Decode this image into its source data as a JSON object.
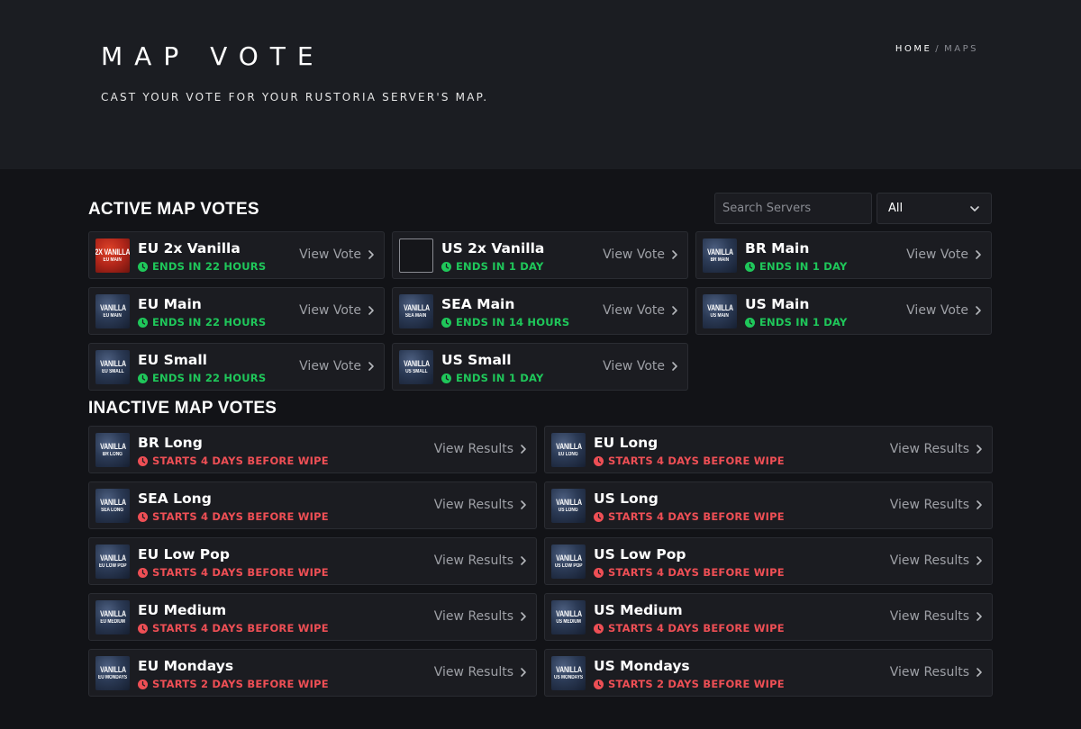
{
  "header": {
    "title": "MAP VOTE",
    "subtitle": "CAST YOUR VOTE FOR YOUR RUSTORIA SERVER'S MAP.",
    "breadcrumb": {
      "home": "HOME",
      "separator": "/",
      "current": "MAPS"
    }
  },
  "active": {
    "heading": "ACTIVE MAP VOTES",
    "search_placeholder": "Search Servers",
    "filter_value": "All",
    "action_label": "View Vote",
    "items": [
      {
        "name": "EU 2x Vanilla",
        "status": "ENDS IN 22 HOURS",
        "thumb_line1": "2X VANILLA",
        "thumb_line2": "EU MAIN",
        "thumb_style": "red"
      },
      {
        "name": "US 2x Vanilla",
        "status": "ENDS IN 1 DAY",
        "thumb_line1": "",
        "thumb_line2": "",
        "thumb_style": "empty"
      },
      {
        "name": "BR Main",
        "status": "ENDS IN 1 DAY",
        "thumb_line1": "VANILLA",
        "thumb_line2": "BR MAIN",
        "thumb_style": "blue"
      },
      {
        "name": "EU Main",
        "status": "ENDS IN 22 HOURS",
        "thumb_line1": "VANILLA",
        "thumb_line2": "EU MAIN",
        "thumb_style": "blue"
      },
      {
        "name": "SEA Main",
        "status": "ENDS IN 14 HOURS",
        "thumb_line1": "VANILLA",
        "thumb_line2": "SEA MAIN",
        "thumb_style": "blue"
      },
      {
        "name": "US Main",
        "status": "ENDS IN 1 DAY",
        "thumb_line1": "VANILLA",
        "thumb_line2": "US MAIN",
        "thumb_style": "blue"
      },
      {
        "name": "EU Small",
        "status": "ENDS IN 22 HOURS",
        "thumb_line1": "VANILLA",
        "thumb_line2": "EU SMALL",
        "thumb_style": "blue"
      },
      {
        "name": "US Small",
        "status": "ENDS IN 1 DAY",
        "thumb_line1": "VANILLA",
        "thumb_line2": "US SMALL",
        "thumb_style": "blue"
      }
    ]
  },
  "inactive": {
    "heading": "INACTIVE MAP VOTES",
    "action_label": "View Results",
    "items": [
      {
        "name": "BR Long",
        "status": "STARTS 4 DAYS BEFORE WIPE",
        "thumb_line1": "VANILLA",
        "thumb_line2": "BR LONG",
        "thumb_style": "blue"
      },
      {
        "name": "EU Long",
        "status": "STARTS 4 DAYS BEFORE WIPE",
        "thumb_line1": "VANILLA",
        "thumb_line2": "EU LONG",
        "thumb_style": "blue"
      },
      {
        "name": "SEA Long",
        "status": "STARTS 4 DAYS BEFORE WIPE",
        "thumb_line1": "VANILLA",
        "thumb_line2": "SEA LONG",
        "thumb_style": "blue"
      },
      {
        "name": "US Long",
        "status": "STARTS 4 DAYS BEFORE WIPE",
        "thumb_line1": "VANILLA",
        "thumb_line2": "US LONG",
        "thumb_style": "blue"
      },
      {
        "name": "EU Low Pop",
        "status": "STARTS 4 DAYS BEFORE WIPE",
        "thumb_line1": "VANILLA",
        "thumb_line2": "EU LOW POP",
        "thumb_style": "blue"
      },
      {
        "name": "US Low Pop",
        "status": "STARTS 4 DAYS BEFORE WIPE",
        "thumb_line1": "VANILLA",
        "thumb_line2": "US LOW POP",
        "thumb_style": "blue"
      },
      {
        "name": "EU Medium",
        "status": "STARTS 4 DAYS BEFORE WIPE",
        "thumb_line1": "VANILLA",
        "thumb_line2": "EU MEDIUM",
        "thumb_style": "blue"
      },
      {
        "name": "US Medium",
        "status": "STARTS 4 DAYS BEFORE WIPE",
        "thumb_line1": "VANILLA",
        "thumb_line2": "US MEDIUM",
        "thumb_style": "blue"
      },
      {
        "name": "EU Mondays",
        "status": "STARTS 2 DAYS BEFORE WIPE",
        "thumb_line1": "VANILLA",
        "thumb_line2": "EU MONDAYS",
        "thumb_style": "blue"
      },
      {
        "name": "US Mondays",
        "status": "STARTS 2 DAYS BEFORE WIPE",
        "thumb_line1": "VANILLA",
        "thumb_line2": "US MONDAYS",
        "thumb_style": "blue"
      }
    ]
  },
  "colors": {
    "active_status": "#1fc75a",
    "inactive_status": "#ee4f55",
    "background": "#121317",
    "hero_background": "#1b1d22"
  },
  "icons": {
    "status": "clock-icon",
    "action": "chevron-right-icon",
    "filter": "chevron-down-icon"
  }
}
